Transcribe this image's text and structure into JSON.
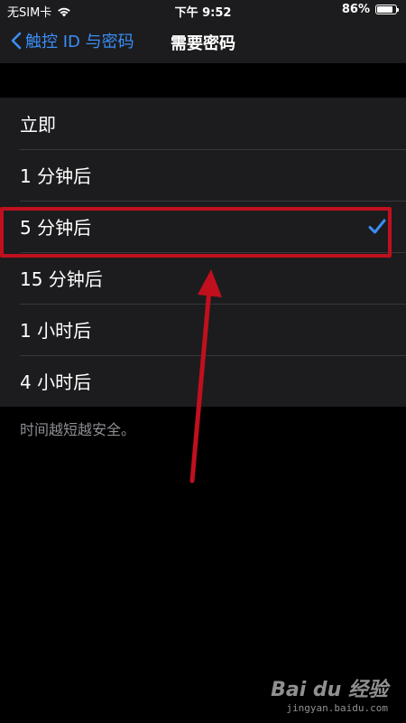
{
  "status_bar": {
    "carrier": "无SIM卡",
    "time": "下午 9:52",
    "battery": "86%",
    "battery_level": 0.86
  },
  "nav": {
    "back_label": "触控 ID 与密码",
    "title": "需要密码"
  },
  "options": [
    {
      "label": "立即",
      "selected": false
    },
    {
      "label": "1 分钟后",
      "selected": false
    },
    {
      "label": "5 分钟后",
      "selected": true
    },
    {
      "label": "15 分钟后",
      "selected": false
    },
    {
      "label": "1 小时后",
      "selected": false
    },
    {
      "label": "4 小时后",
      "selected": false
    }
  ],
  "footer_note": "时间越短越安全。",
  "colors": {
    "accent": "#3a8ef6",
    "annotation": "#c0101e",
    "cell_bg": "#1c1c1e"
  },
  "watermark": {
    "logo": "Bai du 经验",
    "url": "jingyan.baidu.com"
  }
}
